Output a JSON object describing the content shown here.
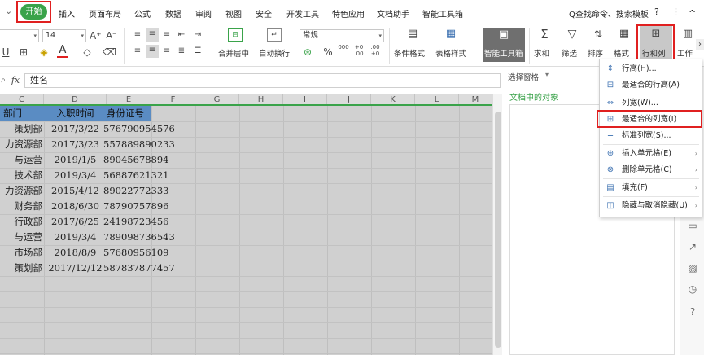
{
  "tabs": {
    "left_arrow": "⌄",
    "start": "开始",
    "insert": "插入",
    "page_layout": "页面布局",
    "formula": "公式",
    "data": "数据",
    "review": "审阅",
    "view": "视图",
    "security": "安全",
    "dev_tools": "开发工具",
    "special_apps": "特色应用",
    "doc_helper": "文档助手",
    "smart_toolbox": "智能工具箱",
    "search": "Q查找命令、搜索模板",
    "help": "?",
    "more": "⋮",
    "collapse": "^"
  },
  "ribbon": {
    "font_size": "14",
    "grow_font": "A⁺",
    "shrink_font": "A⁻",
    "merge_center": "合并居中",
    "wrap_text": "自动换行",
    "number_format": "常规",
    "percent": "%",
    "thousands": "000",
    "inc_decimal": "+0 .00",
    "dec_decimal": ".00 +0",
    "conditional_format": "条件格式",
    "table_style": "表格样式",
    "smart_toolbox": "智能工具箱",
    "sum": "求和",
    "filter": "筛选",
    "sort": "排序",
    "format": "格式",
    "rows_cols": "行和列",
    "worksheet": "工作"
  },
  "formula_bar": {
    "fx": "fx",
    "search_icon": "magnifier",
    "value": "姓名"
  },
  "grid": {
    "columns": [
      "C",
      "D",
      "E",
      "F",
      "G",
      "H",
      "I",
      "J",
      "K",
      "L",
      "M"
    ],
    "headers": [
      "部门",
      "入职时间",
      "身份证号"
    ],
    "rows": [
      [
        "策划部",
        "2017/3/22",
        "576790954576"
      ],
      [
        "力资源部",
        "2017/3/23",
        "557889890233"
      ],
      [
        "与运营",
        "2019/1/5",
        "89045678894"
      ],
      [
        "技术部",
        "2019/3/4",
        "56887621321"
      ],
      [
        "力资源部",
        "2015/4/12",
        "89022772333"
      ],
      [
        "财务部",
        "2018/6/30",
        "78790757896"
      ],
      [
        "行政部",
        "2017/6/25",
        "24198723456"
      ],
      [
        "与运营",
        "2019/3/4",
        "789098736543"
      ],
      [
        "市场部",
        "2018/8/9",
        "57680956109"
      ],
      [
        "策划部",
        "2017/12/12",
        "587837877457"
      ]
    ]
  },
  "pane": {
    "title": "选择窗格",
    "subtitle": "文档中的对象"
  },
  "menu": {
    "items": [
      {
        "label": "行高(H)...",
        "icon": "row-height-icon",
        "sub": ""
      },
      {
        "label": "最适合的行高(A)",
        "icon": "autofit-row-icon",
        "sub": ""
      },
      {
        "label": "列宽(W)...",
        "icon": "col-width-icon",
        "sub": ""
      },
      {
        "label": "最适合的列宽(I)",
        "icon": "autofit-col-icon",
        "sub": ""
      },
      {
        "label": "标准列宽(S)...",
        "icon": "standard-width-icon",
        "sub": ""
      },
      {
        "label": "插入单元格(E)",
        "icon": "insert-cell-icon",
        "sub": "›"
      },
      {
        "label": "删除单元格(C)",
        "icon": "delete-cell-icon",
        "sub": "›"
      },
      {
        "label": "填充(F)",
        "icon": "fill-icon",
        "sub": "›"
      },
      {
        "label": "隐藏与取消隐藏(U)",
        "icon": "hide-unhide-icon",
        "sub": "›"
      }
    ]
  },
  "colors": {
    "start_tab": "#3aa34a",
    "highlight_box": "#e02020",
    "header_fill": "#5a8cc3",
    "selected_grid": "#d0d0d0"
  }
}
